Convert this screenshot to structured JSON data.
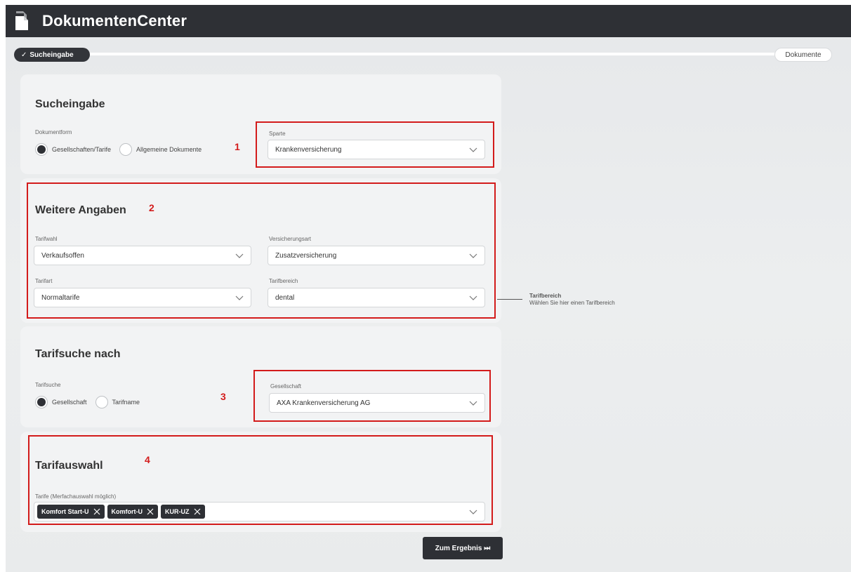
{
  "header": {
    "title": "DokumentenCenter",
    "icon": "documents-icon"
  },
  "stepper": {
    "steps": [
      {
        "label": "Sucheingabe",
        "state": "active"
      },
      {
        "label": "Dokumente",
        "state": "inactive"
      }
    ]
  },
  "sucheingabe": {
    "title": "Sucheingabe",
    "dokumentform_label": "Dokumentform",
    "radio_options": [
      "Gesellschaften/Tarife",
      "Allgemeine Dokumente"
    ],
    "selected_option": "Gesellschaften/Tarife",
    "sparte_label": "Sparte",
    "sparte_value": "Krankenversicherung"
  },
  "weitere": {
    "title": "Weitere Angaben",
    "tarifwahl_label": "Tarifwahl",
    "tarifwahl_value": "Verkaufsoffen",
    "versicherungsart_label": "Versicherungsart",
    "versicherungsart_value": "Zusatzversicherung",
    "tarifart_label": "Tarifart",
    "tarifart_value": "Normaltarife",
    "tarifbereich_label": "Tarifbereich",
    "tarifbereich_value": "dental"
  },
  "callout": {
    "title": "Tarifbereich",
    "text": "Wählen Sie hier einen Tarifbereich"
  },
  "tarifsuche": {
    "title": "Tarifsuche nach",
    "tarifsuche_label": "Tarifsuche",
    "radio_options": [
      "Gesellschaft",
      "Tarifname"
    ],
    "selected_option": "Gesellschaft",
    "gesellschaft_label": "Gesellschaft",
    "gesellschaft_value": "AXA Krankenversicherung AG"
  },
  "tarifauswahl": {
    "title": "Tarifauswahl",
    "tarife_label": "Tarife (Merfachauswahl möglich)",
    "chips": [
      "Komfort Start-U",
      "Komfort-U",
      "KUR-UZ"
    ]
  },
  "annotations": [
    "1",
    "2",
    "3",
    "4"
  ],
  "result_button": {
    "label": "Zum Ergebnis ⏭"
  },
  "colors": {
    "header": "#2e3035",
    "annotation": "#d31b1b",
    "card": "#f2f3f4"
  }
}
